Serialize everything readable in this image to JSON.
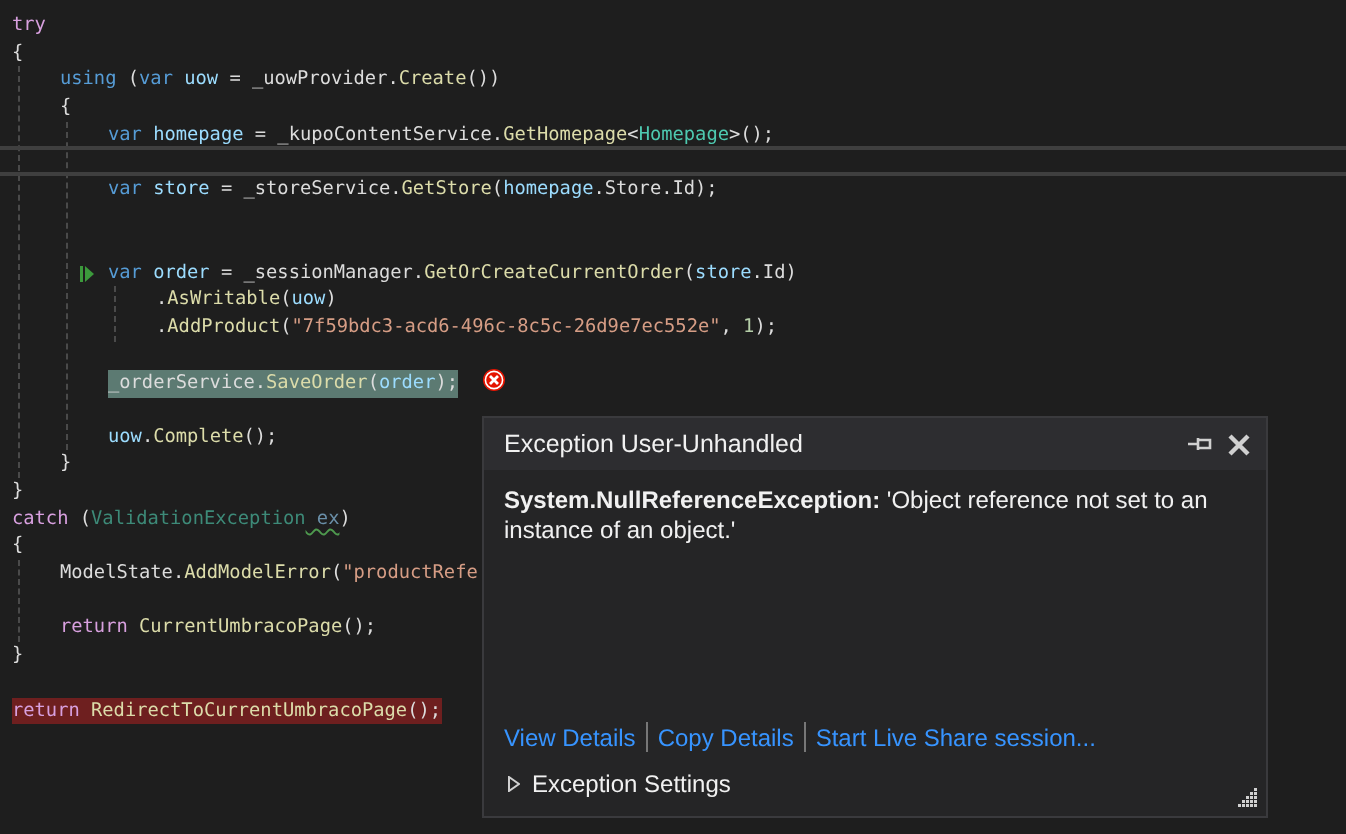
{
  "editor": {
    "lines": [
      {
        "kind": "code",
        "tokens": [
          {
            "kind": "ctrl",
            "text": "try"
          }
        ]
      },
      {
        "kind": "code",
        "tokens": [
          {
            "kind": "plain",
            "text": "{"
          }
        ],
        "children": [
          {
            "kind": "code",
            "tokens": [
              {
                "kind": "kw",
                "text": "using"
              },
              {
                "kind": "plain",
                "text": " ("
              },
              {
                "kind": "kw",
                "text": "var"
              },
              {
                "kind": "var",
                "text": " uow"
              },
              {
                "kind": "plain",
                "text": " = _uowProvider."
              },
              {
                "kind": "method",
                "text": "Create"
              },
              {
                "kind": "plain",
                "text": "())"
              }
            ]
          },
          {
            "kind": "code",
            "tokens": [
              {
                "kind": "plain",
                "text": "{"
              }
            ],
            "children": [
              {
                "kind": "code",
                "tokens": [
                  {
                    "kind": "kw",
                    "text": "var"
                  },
                  {
                    "kind": "var",
                    "text": " homepage"
                  },
                  {
                    "kind": "plain",
                    "text": " = _kupoContentService."
                  },
                  {
                    "kind": "method",
                    "text": "GetHomepage"
                  },
                  {
                    "kind": "plain",
                    "text": "<"
                  },
                  {
                    "kind": "type",
                    "text": "Homepage"
                  },
                  {
                    "kind": "plain",
                    "text": ">();"
                  }
                ]
              },
              {
                "kind": "divider"
              },
              {
                "kind": "code",
                "tokens": [
                  {
                    "kind": "kw",
                    "text": "var"
                  },
                  {
                    "kind": "var",
                    "text": " store"
                  },
                  {
                    "kind": "plain",
                    "text": " = _storeService."
                  },
                  {
                    "kind": "method",
                    "text": "GetStore"
                  },
                  {
                    "kind": "plain",
                    "text": "("
                  },
                  {
                    "kind": "var",
                    "text": "homepage"
                  },
                  {
                    "kind": "plain",
                    "text": ".Store.Id);"
                  }
                ]
              },
              {
                "kind": "blank"
              },
              {
                "kind": "blank"
              },
              {
                "kind": "code",
                "run_arrow": true,
                "tokens": [
                  {
                    "kind": "kw",
                    "text": "var"
                  },
                  {
                    "kind": "var",
                    "text": " order"
                  },
                  {
                    "kind": "plain",
                    "text": " = _sessionManager."
                  },
                  {
                    "kind": "method",
                    "text": "GetOrCreateCurrentOrder"
                  },
                  {
                    "kind": "plain",
                    "text": "("
                  },
                  {
                    "kind": "var",
                    "text": "store"
                  },
                  {
                    "kind": "plain",
                    "text": ".Id)"
                  }
                ],
                "children": [
                  {
                    "kind": "code",
                    "tokens": [
                      {
                        "kind": "plain",
                        "text": "."
                      },
                      {
                        "kind": "method",
                        "text": "AsWritable"
                      },
                      {
                        "kind": "plain",
                        "text": "("
                      },
                      {
                        "kind": "var",
                        "text": "uow"
                      },
                      {
                        "kind": "plain",
                        "text": ")"
                      }
                    ]
                  },
                  {
                    "kind": "code",
                    "tokens": [
                      {
                        "kind": "plain",
                        "text": "."
                      },
                      {
                        "kind": "method",
                        "text": "AddProduct"
                      },
                      {
                        "kind": "plain",
                        "text": "("
                      },
                      {
                        "kind": "str",
                        "text": "\"7f59bdc3-acd6-496c-8c5c-26d9e7ec552e\""
                      },
                      {
                        "kind": "plain",
                        "text": ", "
                      },
                      {
                        "kind": "num",
                        "text": "1"
                      },
                      {
                        "kind": "plain",
                        "text": ");"
                      }
                    ]
                  }
                ]
              },
              {
                "kind": "blank"
              },
              {
                "kind": "code",
                "current": true,
                "error_icon": true,
                "tokens": [
                  {
                    "kind": "plain",
                    "text": "_orderService."
                  },
                  {
                    "kind": "method",
                    "text": "SaveOrder"
                  },
                  {
                    "kind": "plain",
                    "text": "("
                  },
                  {
                    "kind": "var",
                    "text": "order"
                  },
                  {
                    "kind": "plain",
                    "text": ");"
                  }
                ]
              },
              {
                "kind": "blank"
              },
              {
                "kind": "code",
                "tokens": [
                  {
                    "kind": "var",
                    "text": "uow"
                  },
                  {
                    "kind": "plain",
                    "text": "."
                  },
                  {
                    "kind": "method",
                    "text": "Complete"
                  },
                  {
                    "kind": "plain",
                    "text": "();"
                  }
                ]
              }
            ]
          },
          {
            "kind": "code",
            "tokens": [
              {
                "kind": "plain",
                "text": "}"
              }
            ]
          }
        ]
      },
      {
        "kind": "code",
        "tokens": [
          {
            "kind": "plain",
            "text": "}"
          }
        ]
      },
      {
        "kind": "code",
        "tokens": [
          {
            "kind": "ctrl",
            "text": "catch"
          },
          {
            "kind": "plain",
            "text": " ("
          },
          {
            "kind": "dimtype",
            "text": "ValidationException"
          },
          {
            "kind": "dimvar",
            "text": " ex",
            "warning": true
          },
          {
            "kind": "plain",
            "text": ")"
          }
        ]
      },
      {
        "kind": "code",
        "tokens": [
          {
            "kind": "plain",
            "text": "{"
          }
        ],
        "children": [
          {
            "kind": "code",
            "tokens": [
              {
                "kind": "plain",
                "text": "ModelState."
              },
              {
                "kind": "method",
                "text": "AddModelError"
              },
              {
                "kind": "plain",
                "text": "("
              },
              {
                "kind": "str",
                "text": "\"productRefe"
              }
            ]
          },
          {
            "kind": "blank"
          },
          {
            "kind": "code",
            "tokens": [
              {
                "kind": "ctrl",
                "text": "return"
              },
              {
                "kind": "method",
                "text": " CurrentUmbracoPage"
              },
              {
                "kind": "plain",
                "text": "();"
              }
            ]
          }
        ]
      },
      {
        "kind": "code",
        "tokens": [
          {
            "kind": "plain",
            "text": "}"
          }
        ]
      },
      {
        "kind": "blank"
      },
      {
        "kind": "code",
        "error": true,
        "tokens": [
          {
            "kind": "ctrl",
            "text": "return"
          },
          {
            "kind": "method",
            "text": " RedirectToCurrentUmbracoPage"
          },
          {
            "kind": "plain",
            "text": "();"
          }
        ]
      }
    ]
  },
  "exception_popup": {
    "title": "Exception User-Unhandled",
    "message": "**System.NullReferenceException:** 'Object reference not set to an instance of an object.'",
    "links": [
      "View Details",
      "Copy Details",
      "Start Live Share session..."
    ],
    "settings": {
      "label": "Exception Settings",
      "expanded": false
    }
  }
}
